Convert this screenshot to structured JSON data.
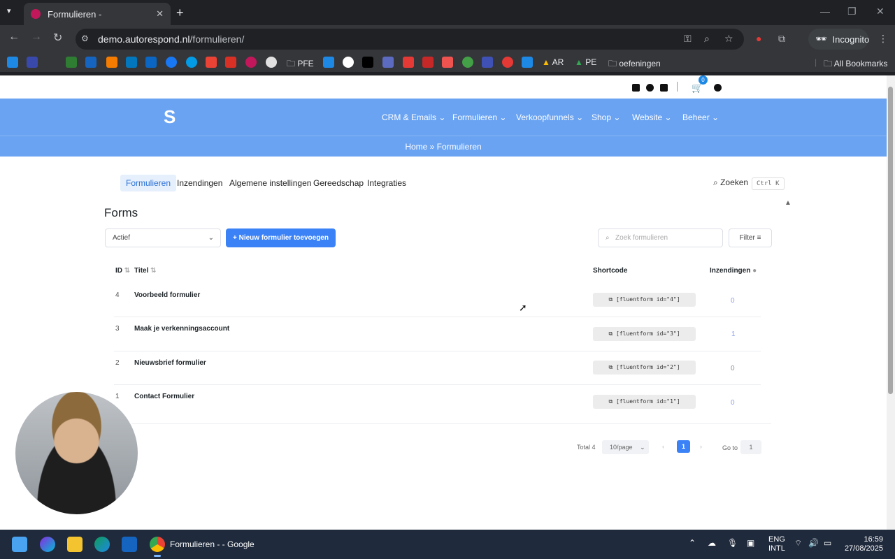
{
  "browser": {
    "tab_title": "Formulieren -",
    "url_host": "demo.autorespond.nl",
    "url_path": "/formulieren/",
    "incognito_label": "Incognito",
    "all_bookmarks": "All Bookmarks",
    "bookmarks": [
      {
        "label": "PFE"
      },
      {
        "label": "AR"
      },
      {
        "label": "PE"
      },
      {
        "label": "oefeningen"
      }
    ]
  },
  "site": {
    "cart_count": "0",
    "nav": [
      "CRM & Emails",
      "Formulieren",
      "Verkoopfunnels",
      "Shop",
      "Website",
      "Beheer"
    ],
    "breadcrumb": "Home » Formulieren"
  },
  "subnav": {
    "items": [
      "Formulieren",
      "Inzendingen",
      "Algemene instellingen",
      "Gereedschap",
      "Integraties"
    ],
    "search_label": "Zoeken",
    "search_shortcut": "Ctrl K"
  },
  "forms": {
    "title": "Forms",
    "status_select": "Actief",
    "add_button": "+ Nieuw formulier toevoegen",
    "search_placeholder": "Zoek formulieren",
    "filter_label": "Filter",
    "columns": {
      "id": "ID",
      "title": "Titel",
      "shortcode": "Shortcode",
      "submissions": "Inzendingen"
    },
    "rows": [
      {
        "id": "4",
        "title": "Voorbeeld formulier",
        "shortcode": "[fluentform id=\"4\"]",
        "submissions": "0"
      },
      {
        "id": "3",
        "title": "Maak je verkenningsaccount",
        "shortcode": "[fluentform id=\"3\"]",
        "submissions": "1"
      },
      {
        "id": "2",
        "title": "Nieuwsbrief formulier",
        "shortcode": "[fluentform id=\"2\"]",
        "submissions": "0"
      },
      {
        "id": "1",
        "title": "Contact Formulier",
        "shortcode": "[fluentform id=\"1\"]",
        "submissions": "0"
      }
    ],
    "pagination": {
      "total": "Total 4",
      "per_page": "10/page",
      "current_page": "1",
      "goto_label": "Go to",
      "goto_value": "1"
    }
  },
  "taskbar": {
    "app_label": "Formulieren - - Google",
    "lang_top": "ENG",
    "lang_bottom": "INTL",
    "time": "16:59",
    "date": "27/08/2025"
  }
}
